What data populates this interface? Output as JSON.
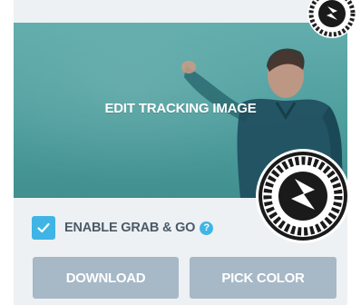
{
  "tracking_image": {
    "overlay_label": "EDIT TRACKING IMAGE"
  },
  "grab_and_go": {
    "label": "ENABLE GRAB & GO",
    "checked": true,
    "help_symbol": "?"
  },
  "buttons": {
    "download_label": "DOWNLOAD",
    "pick_color_label": "PICK COLOR"
  },
  "colors": {
    "accent": "#40b4e5",
    "button_bg": "#a7b8c7",
    "card_bg": "#edf1f4",
    "label_text": "#4b5a68"
  },
  "icons": {
    "corner_badge": "zappar-code-icon",
    "tracking_badge": "zappar-code-icon",
    "checkbox": "checkmark-icon",
    "help": "help-icon"
  }
}
